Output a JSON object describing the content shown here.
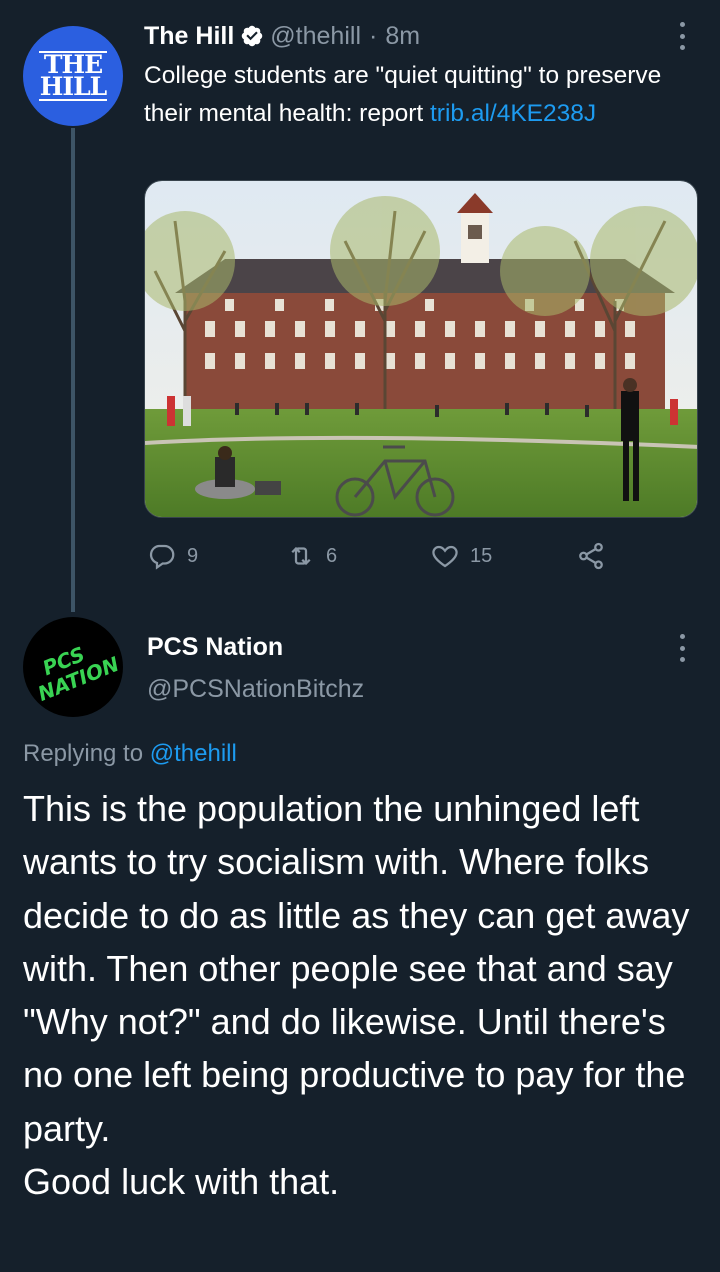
{
  "tweet1": {
    "avatar_text_top": "THE",
    "avatar_text_bottom": "HILL",
    "name": "The Hill",
    "handle": "@thehill",
    "separator": "·",
    "time": "8m",
    "text": "College students are \"quiet quitting\" to preserve their mental health: report ",
    "link": "trib.al/4KE238J",
    "stats": {
      "replies": "9",
      "retweets": "6",
      "likes": "15"
    },
    "colors": {
      "verified": "#ffffff",
      "avatar_bg": "#2b5fe0",
      "link": "#1d9bf0"
    }
  },
  "tweet2": {
    "avatar_text": "PCS NATION",
    "name": "PCS Nation",
    "handle": "@PCSNationBitchz",
    "replying_prefix": "Replying to ",
    "replying_to": "@thehill",
    "body": "This is the population the unhinged left wants to try socialism with. Where folks decide to do as little as they can get away with. Then other people see that and say \"Why not?\" and do likewise. Until there's no one left being productive to pay for the party.\nGood luck with that.",
    "colors": {
      "avatar_text": "#39d353"
    }
  },
  "icons": {
    "more": "more-vertical-icon",
    "reply": "reply-icon",
    "retweet": "retweet-icon",
    "like": "heart-icon",
    "share": "share-icon",
    "verified": "verified-badge-icon"
  },
  "theme": {
    "background": "#15202b",
    "secondary_text": "#8b98a5",
    "thread_line": "#3d5466"
  }
}
